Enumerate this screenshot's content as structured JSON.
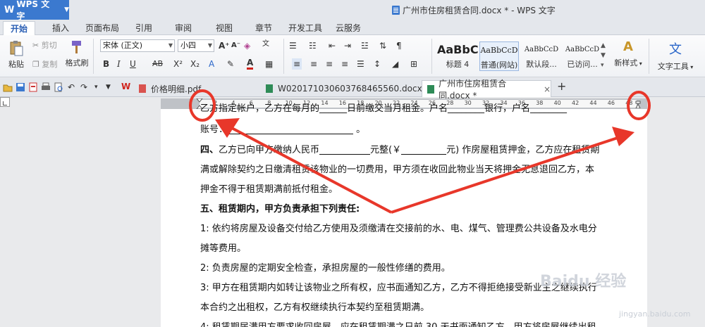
{
  "app": {
    "name": "WPS 文字",
    "window_title": "广州市住房租赁合同.docx * - WPS 文字"
  },
  "menu_tabs": [
    "开始",
    "插入",
    "页面布局",
    "引用",
    "审阅",
    "视图",
    "章节",
    "开发工具",
    "云服务"
  ],
  "ribbon": {
    "paste": "粘贴",
    "cut": "剪切",
    "copy": "复制",
    "format_painter": "格式刷",
    "font_name": "宋体 (正文)",
    "font_size": "小四",
    "styles": [
      {
        "preview": "AaBbC",
        "label": "标题 4"
      },
      {
        "preview": "AaBbCcD",
        "label": "普通(网站)"
      },
      {
        "preview": "AaBbCcD",
        "label": "默认段..."
      },
      {
        "preview": "AaBbCcD",
        "label": "已访问..."
      }
    ],
    "new_style": "新样式",
    "text_tools": "文字工具"
  },
  "doc_tabs": [
    {
      "label": "价格明细.pdf",
      "active": false
    },
    {
      "label": "W020171030603768465560.docx *",
      "active": false
    },
    {
      "label": "广州市住房租赁合同.docx *",
      "active": true
    }
  ],
  "ruler_numbers": [
    "2",
    "4",
    "6",
    "8",
    "10",
    "12",
    "14",
    "16",
    "18",
    "20",
    "22",
    "24",
    "26",
    "28",
    "30",
    "32",
    "34",
    "36",
    "38",
    "40",
    "42",
    "44",
    "46",
    "48"
  ],
  "document": {
    "line0_a": "乙方指定帐户，乙方在每月的______日前缴交当月租金。户名________银行，户名________",
    "line1_a": "账号：",
    "line1_b": "。",
    "line2_a": "四、",
    "line2_b": "乙方已向甲方缴纳人民币",
    "line2_c": "元整(￥",
    "line2_d": "元) 作房屋租赁押金，乙方应在租赁期",
    "line3": "满或解除契约之日缴清租赁该物业的一切费用，甲方须在收回此物业当天将押金无息退回乙方，本",
    "line4": "押金不得于租赁期满前抵付租金。",
    "line5": "五、租赁期内，甲方负责承担下列责任:",
    "line6": "1: 依约将房屋及设备交付给乙方使用及须缴清在交接前的水、电、煤气、管理费公共设备及水电分",
    "line7": "摊等费用。",
    "line8": "2: 负责房屋的定期安全检查，承担房屋的一般性修缮的费用。",
    "line9": "3: 甲方在租赁期内如转让该物业之所有权，应书面通知乙方，乙方不得拒绝接受新业主之继续执行",
    "line10": "本合约之出租权，乙方有权继续执行本契约至租赁期满。",
    "line11": "4: 租赁期届满甲方要求收回房屋，应在租赁期满之日前 30 天书面通知乙方，甲方将房屋继续出租"
  },
  "watermark": {
    "main": "Baidu 经验",
    "sub": "jingyan.baidu.com"
  },
  "colors": {
    "accent": "#3b79cf",
    "annotation_red": "#e8372a"
  }
}
